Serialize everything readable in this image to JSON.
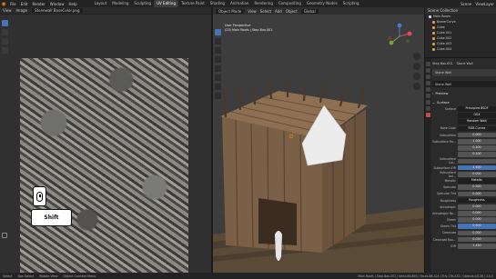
{
  "topbar": {
    "menu": [
      "File",
      "Edit",
      "Render",
      "Window",
      "Help"
    ],
    "workspaces": [
      "Layout",
      "Modeling",
      "Sculpting",
      "UV Editing",
      "Texture Paint",
      "Shading",
      "Animation",
      "Rendering",
      "Compositing",
      "Geometry Nodes",
      "Scripting"
    ],
    "active_workspace": "UV Editing",
    "scene": "Scene",
    "view_layer": "ViewLayer"
  },
  "image_editor": {
    "view_label": "View",
    "image_label": "Image",
    "image_name": "Stonewall BaseColor.png",
    "key_mouse": "mouse",
    "key_shift": "Shift"
  },
  "viewport": {
    "mode": "Object Mode",
    "menus": [
      "View",
      "Select",
      "Add",
      "Object"
    ],
    "orientation": "Global",
    "info_line1": "User Perspective",
    "info_line2": "(23) Main Roofs | Step Box.001"
  },
  "outliner": {
    "title": "Scene Collection",
    "items": [
      {
        "label": "Main Room",
        "level": 0,
        "selected": false
      },
      {
        "label": "BezierCurve",
        "level": 1,
        "selected": false
      },
      {
        "label": "Cube",
        "level": 1,
        "selected": false
      },
      {
        "label": "Cube.001",
        "level": 1,
        "selected": false
      },
      {
        "label": "Cube.002",
        "level": 1,
        "selected": false
      },
      {
        "label": "Cube.003",
        "level": 1,
        "selected": false
      },
      {
        "label": "Cube.004",
        "level": 1,
        "selected": false
      }
    ]
  },
  "properties": {
    "breadcrumb": [
      "Step Box.001",
      "Stone Wall"
    ],
    "material": "Stone Wall",
    "slot": "Stone Wall",
    "preview_label": "Preview",
    "surface_section": "Surface",
    "rows": [
      {
        "label": "Surface",
        "value": "Principled BSDF",
        "style": "dark"
      },
      {
        "label": "",
        "value": "GGX",
        "style": "dark"
      },
      {
        "label": "",
        "value": "Random Walk",
        "style": "dark"
      },
      {
        "label": "Base Color",
        "value": "RGB Curves",
        "style": "dark"
      },
      {
        "label": "Subsurface",
        "value": "0.000",
        "style": ""
      },
      {
        "label": "Subsurface Ra...",
        "value": "1.000",
        "style": ""
      },
      {
        "label": "",
        "value": "0.200",
        "style": ""
      },
      {
        "label": "",
        "value": "0.100",
        "style": ""
      },
      {
        "label": "Subsurface Col...",
        "value": "",
        "style": ""
      },
      {
        "label": "Subsurface IOR",
        "value": "1.400",
        "style": "blue"
      },
      {
        "label": "Subsurface Ani...",
        "value": "0.000",
        "style": ""
      },
      {
        "label": "Metallic",
        "value": "Metallic",
        "style": "dark"
      },
      {
        "label": "Specular",
        "value": "0.500",
        "style": ""
      },
      {
        "label": "Specular Tint",
        "value": "0.000",
        "style": ""
      },
      {
        "label": "Roughness",
        "value": "Roughness",
        "style": "dark"
      },
      {
        "label": "Anisotropic",
        "value": "0.000",
        "style": ""
      },
      {
        "label": "Anisotropic Ro...",
        "value": "0.000",
        "style": ""
      },
      {
        "label": "Sheen",
        "value": "0.000",
        "style": ""
      },
      {
        "label": "Sheen Tint",
        "value": "0.500",
        "style": "blue"
      },
      {
        "label": "Clearcoat",
        "value": "0.000",
        "style": ""
      },
      {
        "label": "Clearcoat Rou...",
        "value": "0.030",
        "style": ""
      },
      {
        "label": "IOR",
        "value": "1.450",
        "style": ""
      }
    ]
  },
  "statusbar": {
    "items": [
      "Select",
      "Box Select",
      "Rotate View",
      "Object Context Menu"
    ],
    "stats": "Main Roofs | Step Box.001 | Verts:89,890 | Faces:88,424 | Tris:176,432 | Objects:0/138 | 3.0.0"
  }
}
